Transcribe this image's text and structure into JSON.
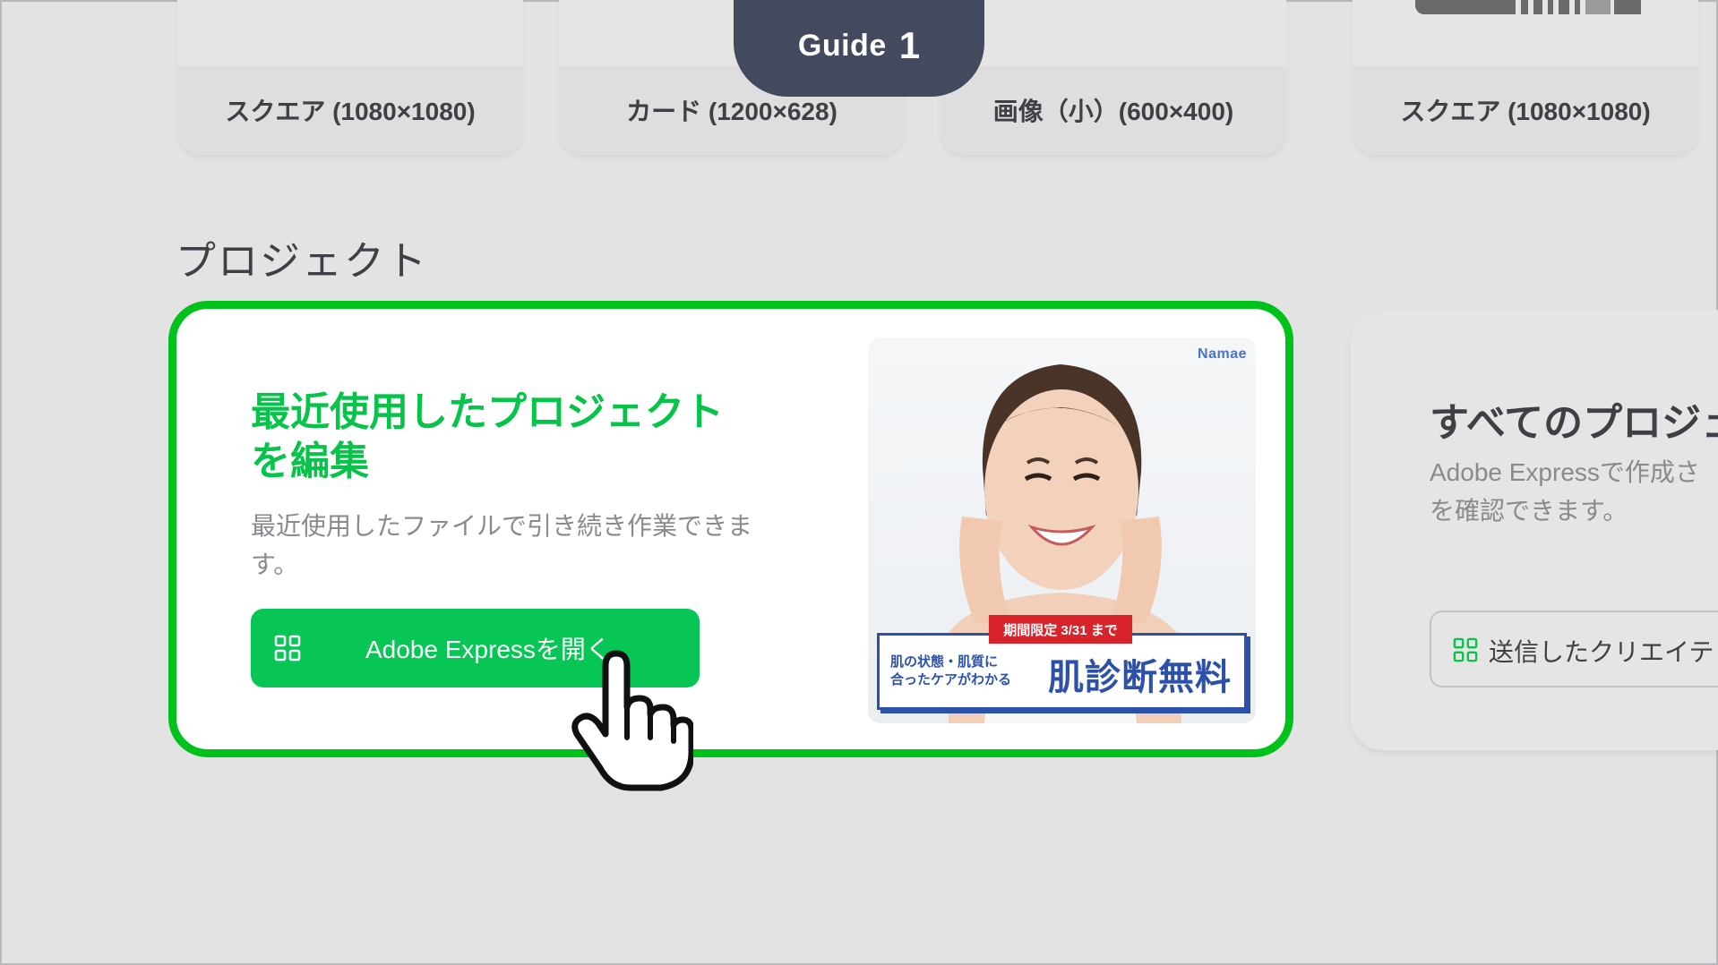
{
  "guide": {
    "label": "Guide",
    "step": "1"
  },
  "templates": [
    {
      "label": "スクエア (1080×1080)"
    },
    {
      "label": "カード (1200×628)"
    },
    {
      "label": "画像（小）(600×400)"
    },
    {
      "label": "スクエア (1080×1080)"
    }
  ],
  "section": {
    "title": "プロジェクト"
  },
  "recent_card": {
    "title": "最近使用したプロジェクトを編集",
    "description": "最近使用したファイルで引き続き作業できます。",
    "button_label": "Adobe Expressを開く",
    "image": {
      "brand": "Namae",
      "ribbon": "期間限定 3/31 まで",
      "small_line1": "肌の状態・肌質に",
      "small_line2": "合ったケアがわかる",
      "headline": "肌診断無料"
    }
  },
  "all_card": {
    "title": "すべてのプロジェ",
    "description_line1": "Adobe Expressで作成さ",
    "description_line2": "を確認できます。",
    "button_label": "送信したクリエイテ"
  },
  "colors": {
    "accent_green": "#00c21a",
    "button_green": "#07c655",
    "guide_bg": "#444a5e",
    "ad_blue": "#2d51a8",
    "ad_red": "#d8232a"
  }
}
